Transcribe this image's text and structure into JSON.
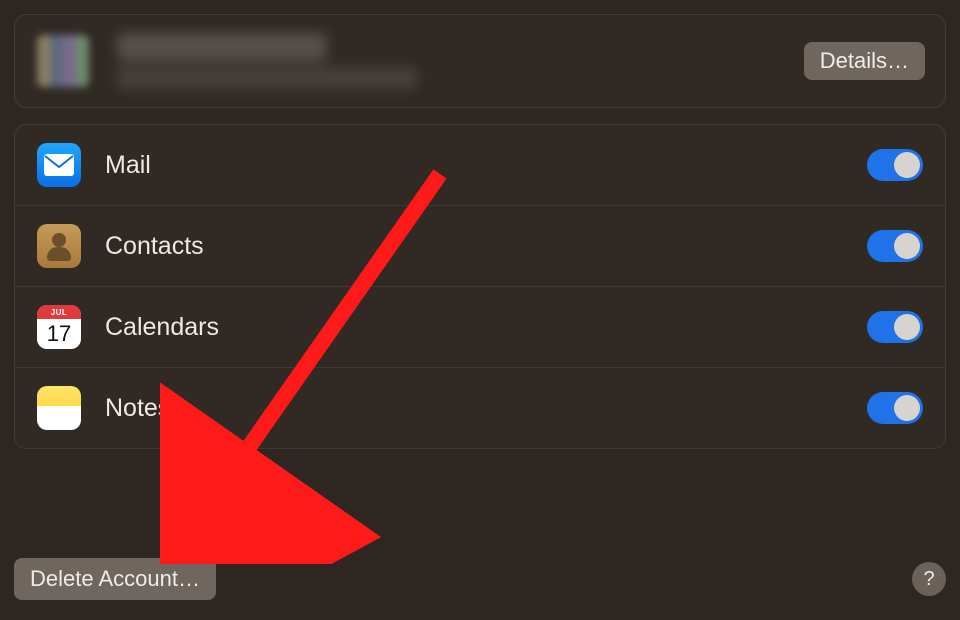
{
  "account": {
    "details_label": "Details…"
  },
  "services": [
    {
      "icon": "mail",
      "label": "Mail",
      "enabled": true
    },
    {
      "icon": "contacts",
      "label": "Contacts",
      "enabled": true
    },
    {
      "icon": "calendars",
      "label": "Calendars",
      "enabled": true,
      "cal_month": "JUL",
      "cal_day": "17"
    },
    {
      "icon": "notes",
      "label": "Notes",
      "enabled": true
    }
  ],
  "footer": {
    "delete_label": "Delete Account…",
    "help_label": "?"
  },
  "annotation": {
    "arrow_color": "#ff1a1a"
  }
}
